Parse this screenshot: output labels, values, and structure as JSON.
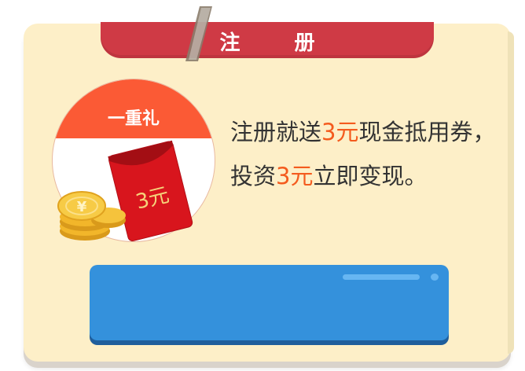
{
  "header": {
    "title": "注 册"
  },
  "gift": {
    "badge_label": "一重礼",
    "envelope_label": "3元",
    "coin_symbol": "¥"
  },
  "promo": {
    "part1": "注册就送",
    "amount1": "3元",
    "part2": "现金抵用券，投资",
    "amount2": "3元",
    "part3": "立即变现。"
  },
  "cta": {
    "label": ""
  },
  "colors": {
    "card_bg": "#fdefc8",
    "ribbon": "#cf3a45",
    "highlight": "#f45b1e",
    "button": "#3491dc",
    "gift_band": "#fb5a35"
  }
}
